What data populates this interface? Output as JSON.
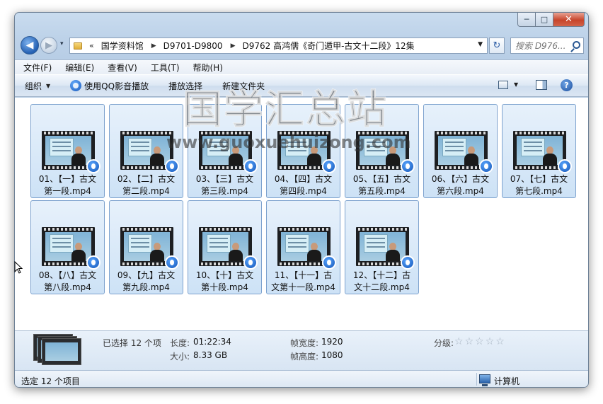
{
  "window": {
    "caption_buttons": {
      "minimize": "─",
      "maximize": "□",
      "close": "✕"
    }
  },
  "navigation": {
    "back_glyph": "◀",
    "forward_glyph": "▶",
    "recent_glyph": "▾",
    "address_overflow": "«",
    "breadcrumbs": [
      {
        "label": "国学资料馆"
      },
      {
        "label": "D9701-D9800"
      },
      {
        "label": "D9762 高鸿儒《奇门遁甲-古文十二段》12集"
      }
    ],
    "refresh_glyph": "↻",
    "search_placeholder": "搜索 D976..."
  },
  "menu": [
    "文件(F)",
    "编辑(E)",
    "查看(V)",
    "工具(T)",
    "帮助(H)"
  ],
  "toolbar": {
    "organize": "组织",
    "play_with_qq": "使用QQ影音播放",
    "play_selection": "播放选择",
    "new_folder": "新建文件夹",
    "help_glyph": "?"
  },
  "files": [
    {
      "line1": "01、【一】古文",
      "line2": "第一段.mp4"
    },
    {
      "line1": "02、【二】古文",
      "line2": "第二段.mp4"
    },
    {
      "line1": "03、【三】古文",
      "line2": "第三段.mp4"
    },
    {
      "line1": "04、【四】古文",
      "line2": "第四段.mp4"
    },
    {
      "line1": "05、【五】古文",
      "line2": "第五段.mp4"
    },
    {
      "line1": "06、【六】古文",
      "line2": "第六段.mp4"
    },
    {
      "line1": "07、【七】古文",
      "line2": "第七段.mp4"
    },
    {
      "line1": "08、【八】古文",
      "line2": "第八段.mp4"
    },
    {
      "line1": "09、【九】古文",
      "line2": "第九段.mp4"
    },
    {
      "line1": "10、【十】古文",
      "line2": "第十段.mp4"
    },
    {
      "line1": "11、【十一】古",
      "line2": "文第十一段.mp4"
    },
    {
      "line1": "12、【十二】古",
      "line2": "文十二段.mp4"
    }
  ],
  "watermark": {
    "text": "国学汇总站",
    "url": "www.guoxuehuizong.com"
  },
  "details": {
    "selected": "已选择 12 个项",
    "length_label": "长度:",
    "length_value": "01:22:34",
    "size_label": "大小:",
    "size_value": "8.33 GB",
    "frame_width_label": "帧宽度:",
    "frame_width_value": "1920",
    "frame_height_label": "帧高度:",
    "frame_height_value": "1080",
    "rating_label": "分级:",
    "rating_stars": 0
  },
  "status": {
    "text": "选定 12 个项目",
    "computer": "计算机"
  }
}
